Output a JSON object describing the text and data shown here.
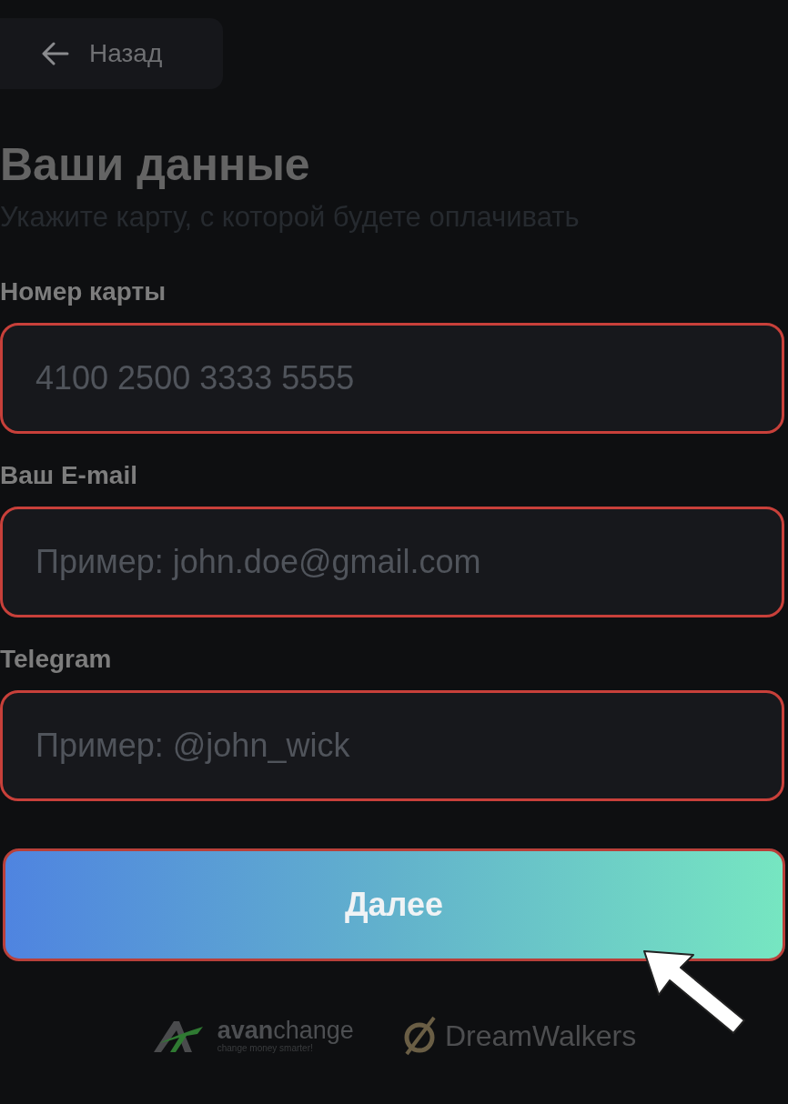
{
  "back_button": {
    "label": "Назад"
  },
  "title": "Ваши данные",
  "subtitle": "Укажите карту, с которой будете оплачивать",
  "fields": [
    {
      "label": "Номер карты",
      "placeholder": "4100 2500 3333 5555"
    },
    {
      "label": "Ваш E-mail",
      "placeholder": "Пример: john.doe@gmail.com"
    },
    {
      "label": "Telegram",
      "placeholder": "Пример: @john_wick"
    }
  ],
  "submit_button": {
    "label": "Далее"
  },
  "partners": [
    {
      "kind": "avan",
      "name_bold": "avan",
      "name_rest": "change",
      "tagline": "change money smarter!"
    },
    {
      "kind": "dream",
      "name": "DreamWalkers"
    }
  ]
}
